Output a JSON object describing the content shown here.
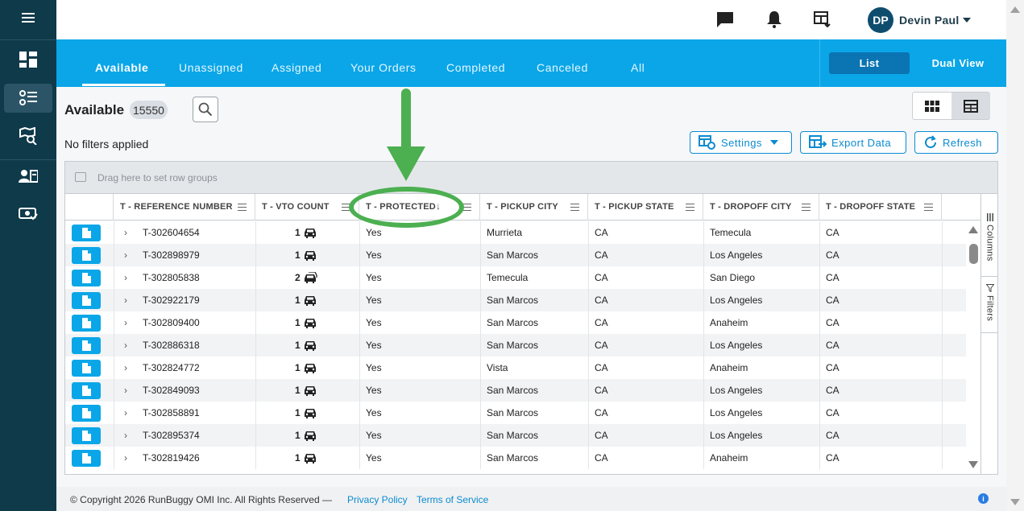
{
  "header": {
    "user_initials": "DP",
    "user_name": "Devin Paul"
  },
  "tabs": [
    {
      "label": "Available",
      "active": true
    },
    {
      "label": "Unassigned"
    },
    {
      "label": "Assigned"
    },
    {
      "label": "Your Orders"
    },
    {
      "label": "Completed"
    },
    {
      "label": "Canceled"
    },
    {
      "label": "All"
    }
  ],
  "view_modes": {
    "list": "List",
    "dual": "Dual View"
  },
  "summary": {
    "title": "Available",
    "count": "15550",
    "filters_text": "No filters applied"
  },
  "actions": {
    "settings": "Settings",
    "export": "Export Data",
    "refresh": "Refresh"
  },
  "grid": {
    "group_placeholder": "Drag here to set row groups",
    "columns": [
      "T - REFERENCE NUMBER",
      "T - VTO COUNT",
      "T - PROTECTED",
      "T - PICKUP CITY",
      "T - PICKUP STATE",
      "T - DROPOFF CITY",
      "T - DROPOFF STATE"
    ],
    "rows": [
      {
        "ref": "T-302604654",
        "vto": "1",
        "multi": false,
        "protected": "Yes",
        "pickup_city": "Murrieta",
        "pickup_state": "CA",
        "dropoff_city": "Temecula",
        "dropoff_state": "CA"
      },
      {
        "ref": "T-302898979",
        "vto": "1",
        "multi": false,
        "protected": "Yes",
        "pickup_city": "San Marcos",
        "pickup_state": "CA",
        "dropoff_city": "Los Angeles",
        "dropoff_state": "CA"
      },
      {
        "ref": "T-302805838",
        "vto": "2",
        "multi": true,
        "protected": "Yes",
        "pickup_city": "Temecula",
        "pickup_state": "CA",
        "dropoff_city": "San Diego",
        "dropoff_state": "CA"
      },
      {
        "ref": "T-302922179",
        "vto": "1",
        "multi": false,
        "protected": "Yes",
        "pickup_city": "San Marcos",
        "pickup_state": "CA",
        "dropoff_city": "Los Angeles",
        "dropoff_state": "CA"
      },
      {
        "ref": "T-302809400",
        "vto": "1",
        "multi": false,
        "protected": "Yes",
        "pickup_city": "San Marcos",
        "pickup_state": "CA",
        "dropoff_city": "Anaheim",
        "dropoff_state": "CA"
      },
      {
        "ref": "T-302886318",
        "vto": "1",
        "multi": false,
        "protected": "Yes",
        "pickup_city": "San Marcos",
        "pickup_state": "CA",
        "dropoff_city": "Los Angeles",
        "dropoff_state": "CA"
      },
      {
        "ref": "T-302824772",
        "vto": "1",
        "multi": false,
        "protected": "Yes",
        "pickup_city": "Vista",
        "pickup_state": "CA",
        "dropoff_city": "Anaheim",
        "dropoff_state": "CA"
      },
      {
        "ref": "T-302849093",
        "vto": "1",
        "multi": false,
        "protected": "Yes",
        "pickup_city": "San Marcos",
        "pickup_state": "CA",
        "dropoff_city": "Los Angeles",
        "dropoff_state": "CA"
      },
      {
        "ref": "T-302858891",
        "vto": "1",
        "multi": false,
        "protected": "Yes",
        "pickup_city": "San Marcos",
        "pickup_state": "CA",
        "dropoff_city": "Los Angeles",
        "dropoff_state": "CA"
      },
      {
        "ref": "T-302895374",
        "vto": "1",
        "multi": false,
        "protected": "Yes",
        "pickup_city": "San Marcos",
        "pickup_state": "CA",
        "dropoff_city": "Los Angeles",
        "dropoff_state": "CA"
      },
      {
        "ref": "T-302819426",
        "vto": "1",
        "multi": false,
        "protected": "Yes",
        "pickup_city": "San Marcos",
        "pickup_state": "CA",
        "dropoff_city": "Anaheim",
        "dropoff_state": "CA"
      }
    ]
  },
  "side_panel": {
    "columns": "Columns",
    "filters": "Filters"
  },
  "footer": {
    "copyright": "© Copyright 2026 RunBuggy OMI Inc. All Rights Reserved —",
    "privacy": "Privacy Policy",
    "terms": "Terms of Service"
  },
  "colors": {
    "sidebar": "#0f3a4a",
    "tabbar": "#0aa6e8",
    "accent": "#0a8bd0",
    "annotation": "#4caf50"
  },
  "icons": [
    "hamburger-icon",
    "dashboard-icon",
    "list-icon",
    "map-search-icon",
    "id-card-icon",
    "money-check-icon",
    "chat-icon",
    "bell-icon",
    "table-download-icon",
    "search-icon",
    "grid-icon",
    "table-icon",
    "settings-icon",
    "export-icon",
    "refresh-icon",
    "document-icon",
    "car-icon"
  ]
}
